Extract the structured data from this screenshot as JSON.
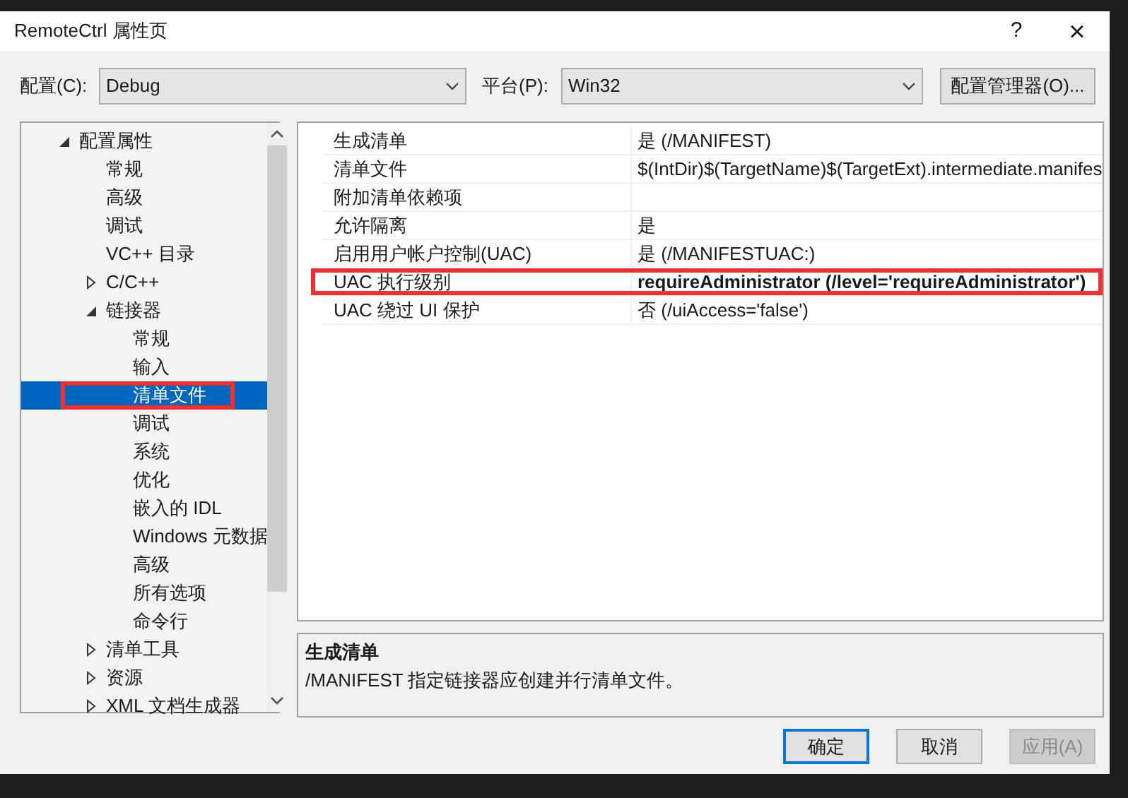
{
  "window": {
    "title": "RemoteCtrl 属性页",
    "help": "?",
    "close": "×"
  },
  "config": {
    "label": "配置(C):",
    "value": "Debug"
  },
  "platform": {
    "label": "平台(P):",
    "value": "Win32"
  },
  "config_manager_button": "配置管理器(O)...",
  "tree": [
    {
      "label": "配置属性",
      "expanded": true,
      "selected": false,
      "children": [
        {
          "label": "常规",
          "selected": false,
          "highlighted": false
        },
        {
          "label": "高级",
          "selected": false,
          "highlighted": false
        },
        {
          "label": "调试",
          "selected": false,
          "highlighted": false
        },
        {
          "label": "VC++ 目录",
          "selected": false,
          "highlighted": false
        },
        {
          "label": "C/C++",
          "expanded": false,
          "selected": false,
          "highlighted": false
        },
        {
          "label": "链接器",
          "expanded": true,
          "selected": false,
          "children": [
            {
              "label": "常规",
              "selected": false,
              "highlighted": false
            },
            {
              "label": "输入",
              "selected": false,
              "highlighted": false
            },
            {
              "label": "清单文件",
              "selected": true,
              "highlighted": true
            },
            {
              "label": "调试",
              "selected": false,
              "highlighted": false
            },
            {
              "label": "系统",
              "selected": false,
              "highlighted": false
            },
            {
              "label": "优化",
              "selected": false,
              "highlighted": false
            },
            {
              "label": "嵌入的 IDL",
              "selected": false,
              "highlighted": false
            },
            {
              "label": "Windows 元数据",
              "selected": false,
              "highlighted": false
            },
            {
              "label": "高级",
              "selected": false,
              "highlighted": false
            },
            {
              "label": "所有选项",
              "selected": false,
              "highlighted": false
            },
            {
              "label": "命令行",
              "selected": false,
              "highlighted": false
            }
          ]
        },
        {
          "label": "清单工具",
          "expanded": false,
          "selected": false,
          "highlighted": false
        },
        {
          "label": "资源",
          "expanded": false,
          "selected": false,
          "highlighted": false
        },
        {
          "label": "XML 文档生成器",
          "expanded": false,
          "selected": false,
          "highlighted": false
        }
      ]
    }
  ],
  "properties": [
    {
      "name": "生成清单",
      "value": "是 (/MANIFEST)",
      "bold": false,
      "highlighted": false
    },
    {
      "name": "清单文件",
      "value": "$(IntDir)$(TargetName)$(TargetExt).intermediate.manifes",
      "bold": false,
      "highlighted": false
    },
    {
      "name": "附加清单依赖项",
      "highlighted": false
    },
    {
      "name": "允许隔离",
      "value": "是",
      "bold": false,
      "highlighted": false
    },
    {
      "name": "启用用户帐户控制(UAC)",
      "value": "是 (/MANIFESTUAC:)",
      "bold": false,
      "highlighted": false
    },
    {
      "name": "UAC 执行级别",
      "value": "requireAdministrator (/level='requireAdministrator')",
      "bold": true,
      "highlighted": true
    },
    {
      "name": "UAC 绕过 UI 保护",
      "value": "否 (/uiAccess='false')",
      "bold": false,
      "highlighted": false
    }
  ],
  "description": {
    "title": "生成清单",
    "text": "/MANIFEST 指定链接器应创建并行清单文件。"
  },
  "buttons": [
    {
      "label": "确定",
      "default": true,
      "disabled": false
    },
    {
      "label": "取消",
      "default": false,
      "disabled": false
    },
    {
      "label": "应用(A)",
      "default": false,
      "disabled": true
    }
  ]
}
